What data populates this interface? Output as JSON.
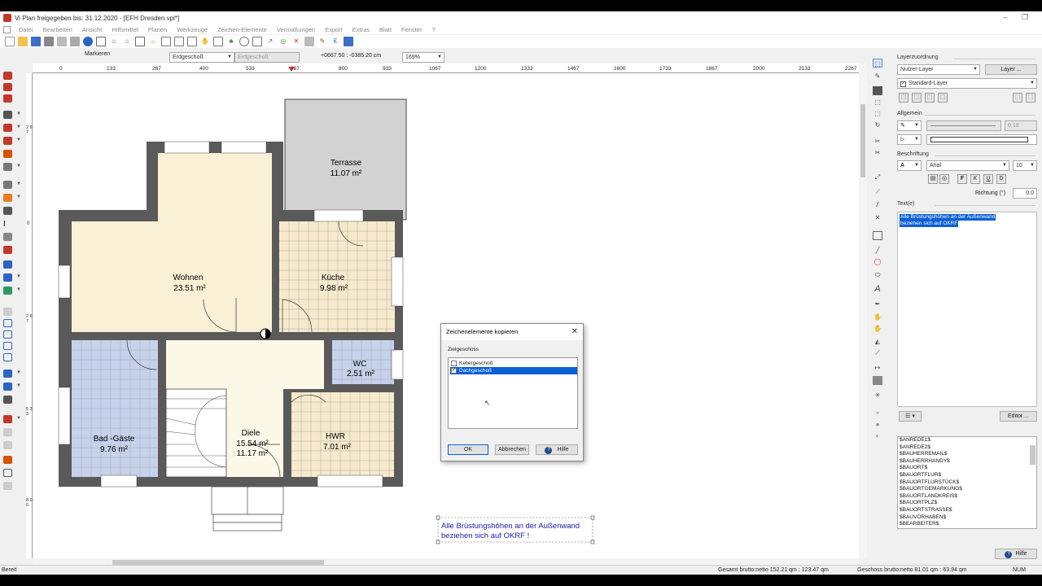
{
  "window": {
    "title": "Vi Plan freigegeben bis: 31.12.2020 - [EFH Dresden.vpl*]",
    "minimize": "–",
    "restore": "❐",
    "close": "✕"
  },
  "menu": [
    "Datei",
    "Bearbeiten",
    "Ansicht",
    "Hilfsmittel",
    "Planen",
    "Werkzeuge",
    "Zeichen-Elemente",
    "Vermaßungen",
    "Export",
    "Extras",
    "Blatt",
    "Fenster",
    "?"
  ],
  "optbar": {
    "mode_label": "Markieren",
    "floor_value": "Erdgeschoß",
    "floor_value2": "Erdgeschoß",
    "coords": "+0667.50 : -0385.20 cm",
    "zoom": "169%"
  },
  "ruler_top": [
    "0",
    "133",
    "267",
    "400",
    "533",
    "667",
    "800",
    "933",
    "1067",
    "1200",
    "1333",
    "1467",
    "1600",
    "1733",
    "1867",
    "2000",
    "2133",
    "2267"
  ],
  "ruler_left": [
    "2 6 7",
    "0",
    "2 6 7",
    "5 3 3",
    "8 0 0"
  ],
  "rooms": [
    {
      "name": "Terrasse",
      "area": "11.07 m²"
    },
    {
      "name": "Wohnen",
      "area": "23.51 m²"
    },
    {
      "name": "Küche",
      "area": "9.98 m²"
    },
    {
      "name": "WC",
      "area": "2.51 m²"
    },
    {
      "name": "Bad -Gäste",
      "area": "9.76 m²"
    },
    {
      "name": "Diele",
      "area": "15.54 m²",
      "area2": "11.17 m²"
    },
    {
      "name": "HWR",
      "area": "7.01 m²"
    }
  ],
  "note_text": {
    "line1": "Alle Brüstungshöhen an der Außenwand",
    "line2": "beziehen sich auf OKRF !"
  },
  "dialog": {
    "title": "Zeichenelemente kopieren",
    "close": "✕",
    "group_label": "Zielgeschoss",
    "items": [
      {
        "label": "Kellergeschoß",
        "checked": false
      },
      {
        "label": "Dachgeschoß",
        "checked": true
      }
    ],
    "ok": "OK",
    "cancel": "Abbrechen",
    "help": "Hilfe",
    "help_icon": "?"
  },
  "right_panel": {
    "layer_section": "Layerzuordnung",
    "layer_type": "Nutzer-Layer",
    "layer_button": "Layer ...",
    "layer_value": "Standard-Layer",
    "general_section": "Allgemein",
    "line_width": "0.18",
    "caption_section": "Beschriftung",
    "font": "Arial",
    "font_size": "10",
    "bold": "F",
    "italic": "K",
    "underline": "U",
    "strike": "D",
    "direction_label": "Richtung (°)",
    "direction_value": "0.0",
    "text_label": "Text(e)",
    "text_line1": "Alle Brüstungshöhen an der Außenwand",
    "text_line2": "beziehen sich auf OKRF",
    "editor_button": "Editor ...",
    "variables": [
      "$ANREDE1$",
      "$ANREDE2$",
      "$BAUHERREMAIL$",
      "$BAUHERRHANDY$",
      "$BAUORT$",
      "$BAUORTFLUR$",
      "$BAUORTFLURSTÜCK$",
      "$BAUORTGEMARKUNG$",
      "$BAUORTLANDKREIS$",
      "$BAUORTPLZ$",
      "$BAUORTSTRASSE$",
      "$BAUVORHABEN$",
      "$BEARBEITER$"
    ],
    "help_button": "Hilfe"
  },
  "status": {
    "left": "Bereit",
    "total": "Gesamt brutto:netto 152.21 qm : 123.47 qm",
    "floor": "Geschoss brutto:netto 81.01 qm : 63.94 qm",
    "num": "NUM"
  },
  "colors": {
    "living": "#faf0d6",
    "blue_tile": "#c6d2ec",
    "kitchen_tile": "#f7eacc",
    "wall": "#555555",
    "selection": "#0a5fd6",
    "text_blue": "#1a1aa6"
  }
}
